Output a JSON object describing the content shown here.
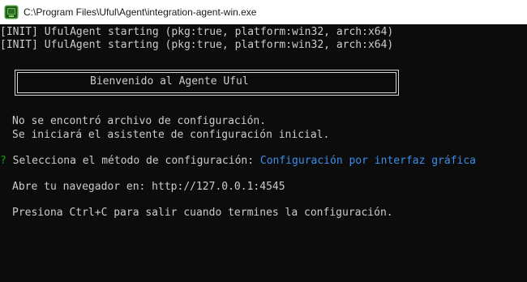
{
  "window": {
    "title": "C:\\Program Files\\Uful\\Agent\\integration-agent-win.exe",
    "icon": "terminal-app-icon"
  },
  "console": {
    "init_lines": [
      "[INIT] UfulAgent starting (pkg:true, platform:win32, arch:x64)",
      "[INIT] UfulAgent starting (pkg:true, platform:win32, arch:x64)"
    ],
    "banner": "Bienvenido al Agente Uful",
    "config_missing": "No se encontró archivo de configuración.",
    "wizard_notice": "Se iniciará el asistente de configuración inicial.",
    "prompt_marker": "?",
    "prompt_question": "Selecciona el método de configuración:",
    "prompt_answer": "Configuración por interfaz gráfica",
    "browser_line": "Abre tu navegador en: http://127.0.0.1:4545",
    "exit_line": "Presiona Ctrl+C para salir cuando termines la configuración.",
    "colors": {
      "background": "#0c0c0c",
      "text": "#cccccc",
      "prompt_marker": "#13a10e",
      "answer": "#3b8eea"
    }
  }
}
